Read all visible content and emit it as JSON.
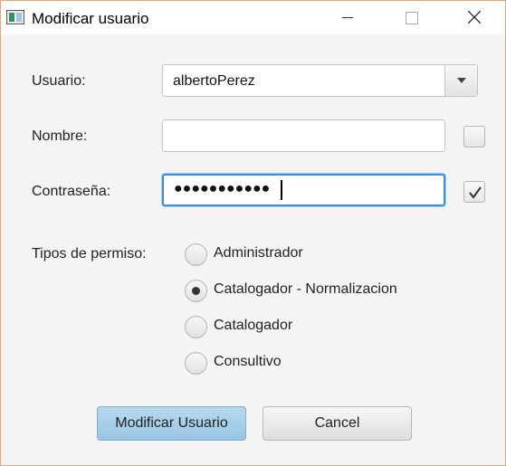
{
  "window": {
    "title": "Modificar usuario"
  },
  "form": {
    "usuario_label": "Usuario:",
    "usuario_value": "albertoPerez",
    "nombre_label": "Nombre:",
    "nombre_value": "",
    "nombre_checked": false,
    "contrasena_label": "Contraseña:",
    "contrasena_masked": "●●●●●●●●●●●",
    "contrasena_checked": true,
    "permisos_label": "Tipos de permiso:",
    "permisos": [
      {
        "label": "Administrador",
        "selected": false
      },
      {
        "label": "Catalogador - Normalizacion",
        "selected": true
      },
      {
        "label": "Catalogador",
        "selected": false
      },
      {
        "label": "Consultivo",
        "selected": false
      }
    ]
  },
  "buttons": {
    "submit": "Modificar Usuario",
    "cancel": "Cancel"
  },
  "colors": {
    "focus": "#3e8ddd",
    "primary_button": "#a8d0ea",
    "window_border": "#f0a36a"
  }
}
